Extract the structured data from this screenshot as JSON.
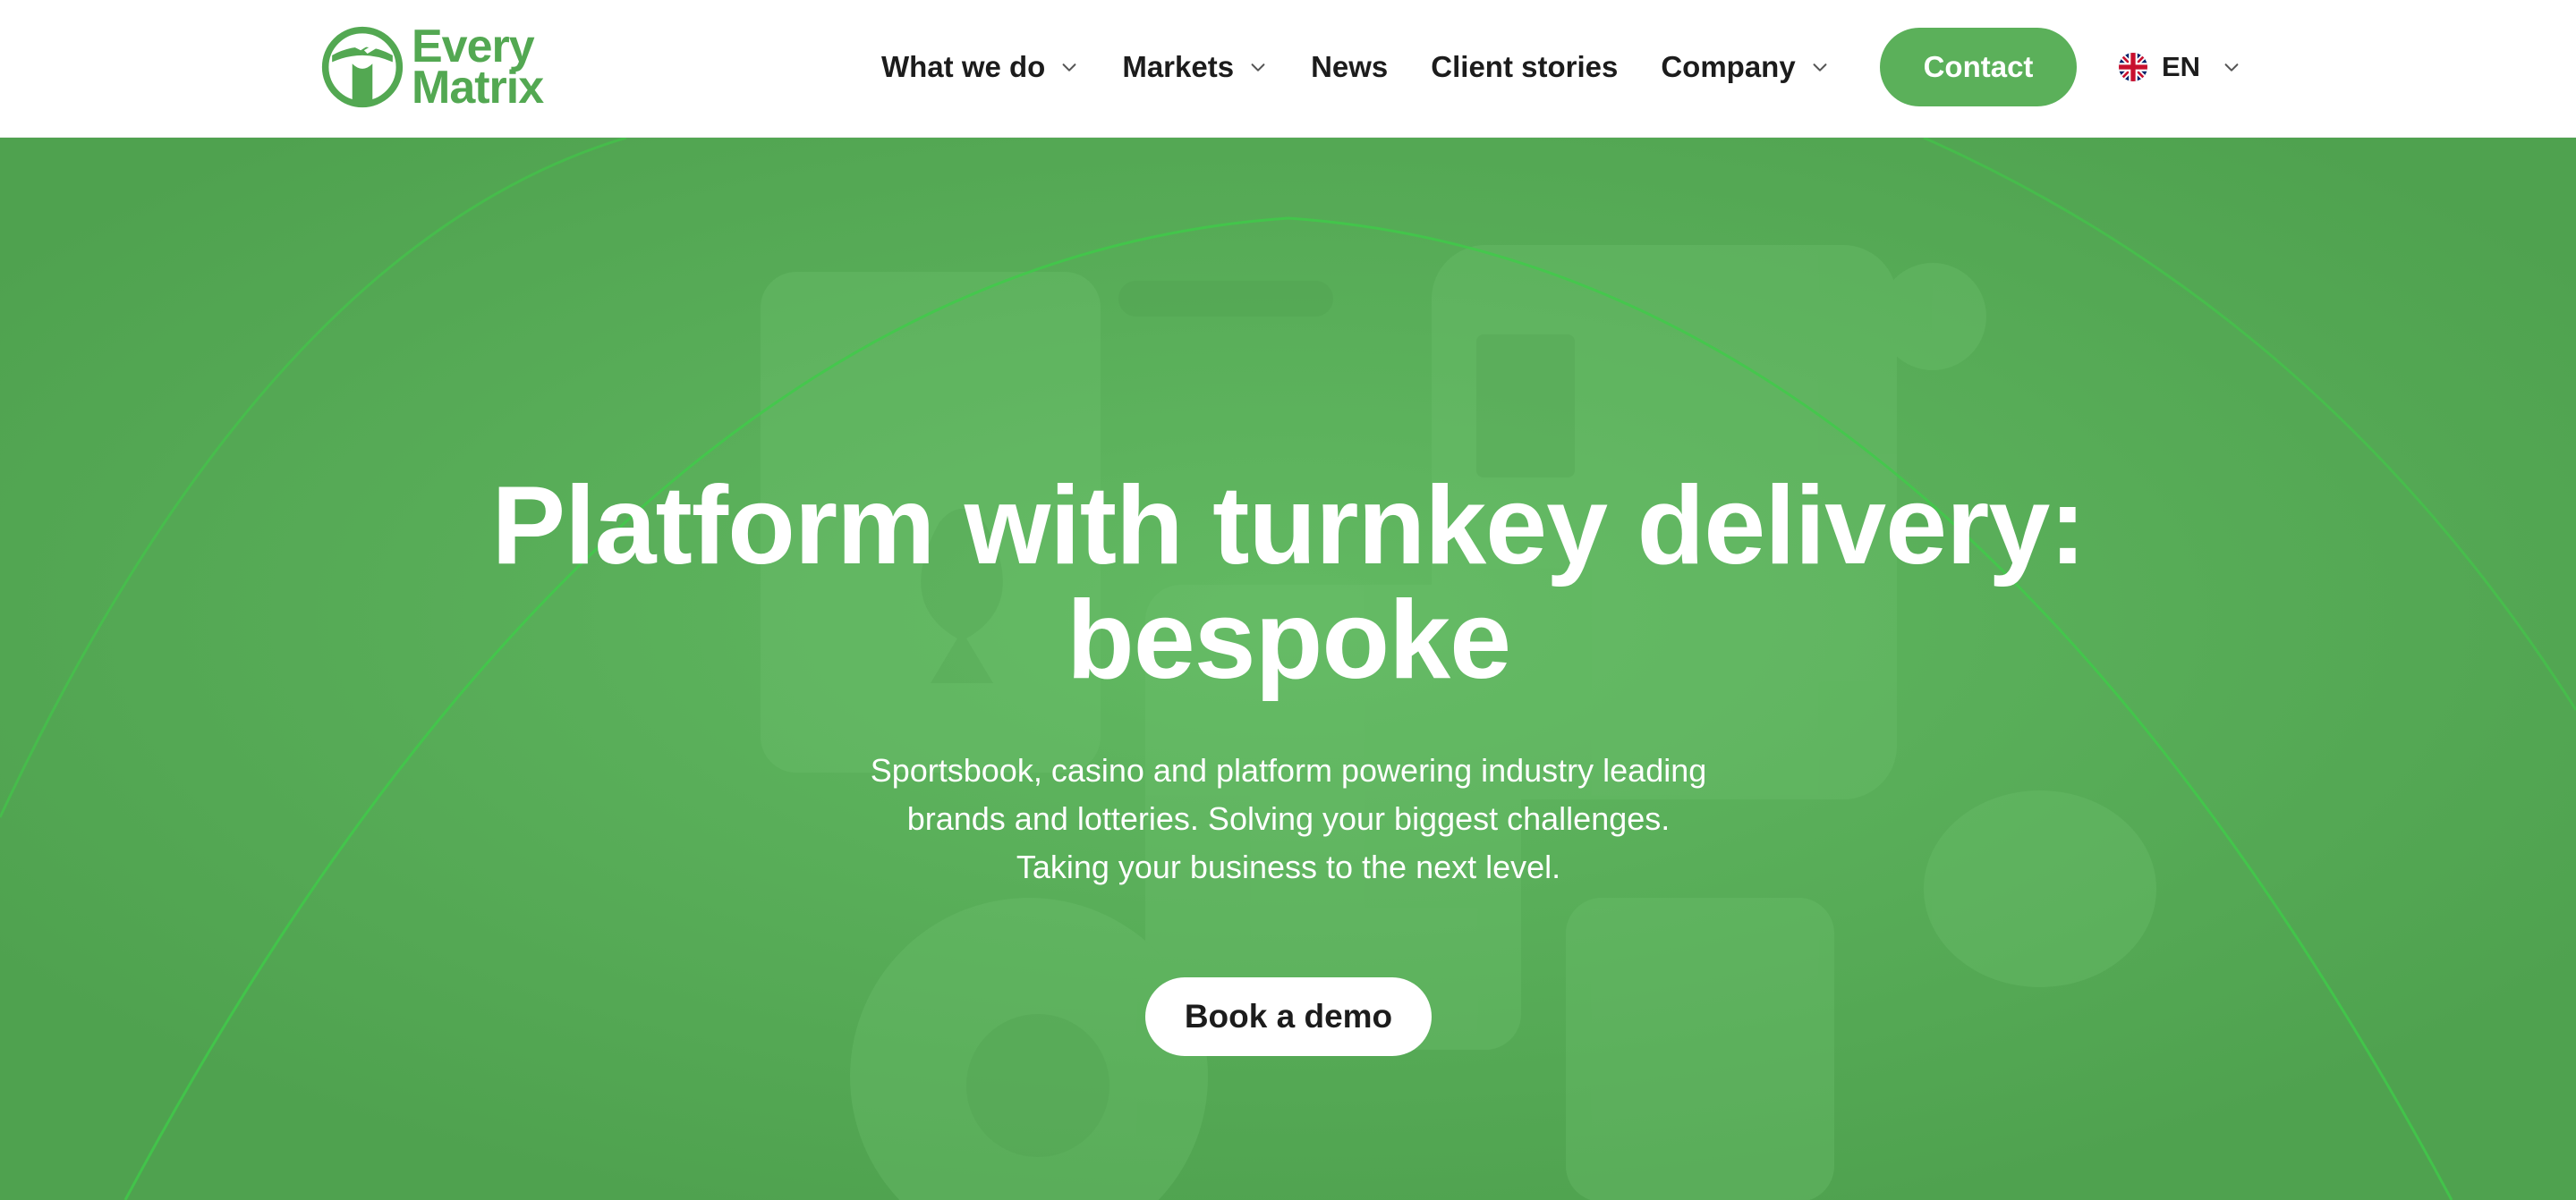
{
  "brand": {
    "name_line1": "Every",
    "name_line2": "Matrix",
    "icon": "everymatrix-logo-icon",
    "color": "#53a852"
  },
  "nav": {
    "items": [
      {
        "label": "What we do",
        "has_dropdown": true
      },
      {
        "label": "Markets",
        "has_dropdown": true
      },
      {
        "label": "News",
        "has_dropdown": false
      },
      {
        "label": "Client stories",
        "has_dropdown": false
      },
      {
        "label": "Company",
        "has_dropdown": true
      }
    ],
    "contact_label": "Contact",
    "language": {
      "label": "EN",
      "flag_icon": "uk-flag-icon",
      "dropdown_icon": "chevron-down-icon"
    }
  },
  "hero": {
    "title_lines": [
      "Platform with turnkey delivery:",
      "bespoke"
    ],
    "subtitle_lines": [
      "Sportsbook, casino and platform powering industry leading",
      "brands and lotteries. Solving your biggest challenges.",
      "Taking your business to the next level."
    ],
    "cta_label": "Book a demo"
  },
  "colors": {
    "accent": "#5bb05a",
    "hero_background": "#58ae58",
    "text_dark": "#1c1c1c",
    "text_light": "#ffffff"
  }
}
